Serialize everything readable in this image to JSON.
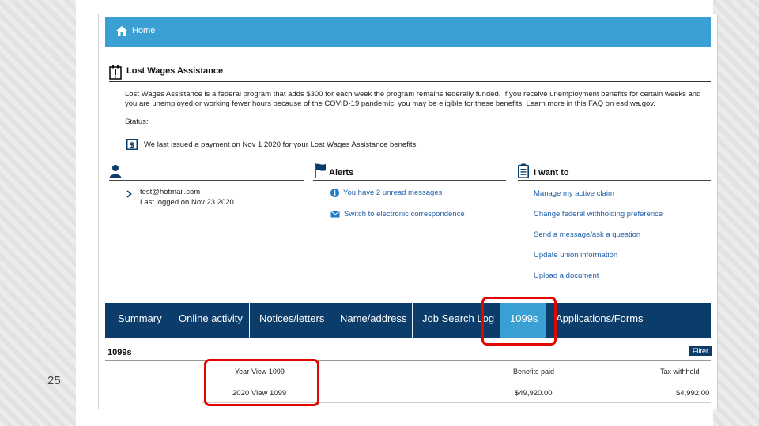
{
  "slide": {
    "number": "25"
  },
  "topbar": {
    "home_label": "Home"
  },
  "lwa": {
    "title": "Lost Wages Assistance",
    "description": "Lost Wages Assistance is a federal program that adds $300 for each week the program remains federally funded. If you receive unemployment benefits for certain weeks and you are unemployed or working fewer hours because of the COVID-19 pandemic, you may be eligible for these benefits. Learn more in this FAQ on esd.wa.gov.",
    "status_label": "Status:",
    "payment_message": "We last issued a payment on Nov 1 2020 for your Lost Wages Assistance benefits."
  },
  "account": {
    "email": "test@hotmail.com",
    "last_logged": "Last logged on Nov 23 2020"
  },
  "alerts": {
    "title": "Alerts",
    "items": [
      "You have 2 unread messages",
      "Switch to electronic correspondence"
    ]
  },
  "i_want_to": {
    "title": "I want to",
    "items": [
      "Manage my active claim",
      "Change federal withholding preference",
      "Send a message/ask a question",
      "Update union information",
      "Upload a document"
    ]
  },
  "tabs": [
    "Summary",
    "Online activity",
    "Notices/letters",
    "Name/address",
    "Job Search Log",
    "1099s",
    "Applications/Forms"
  ],
  "active_tab": "1099s",
  "section_1099": {
    "title": "1099s",
    "filter_label": "Filter",
    "headers": {
      "year": "Year",
      "view": "View 1099",
      "benefits": "Benefits paid",
      "tax": "Tax withheld"
    },
    "rows": [
      {
        "year": "2020",
        "view": "View 1099",
        "benefits": "$49,920.00",
        "tax": "$4,992.00"
      }
    ]
  },
  "colors": {
    "header_blue": "#3aa0d4",
    "nav_navy": "#0b3c6a",
    "link_blue": "#1f5fa8",
    "highlight_red": "#e10600"
  }
}
